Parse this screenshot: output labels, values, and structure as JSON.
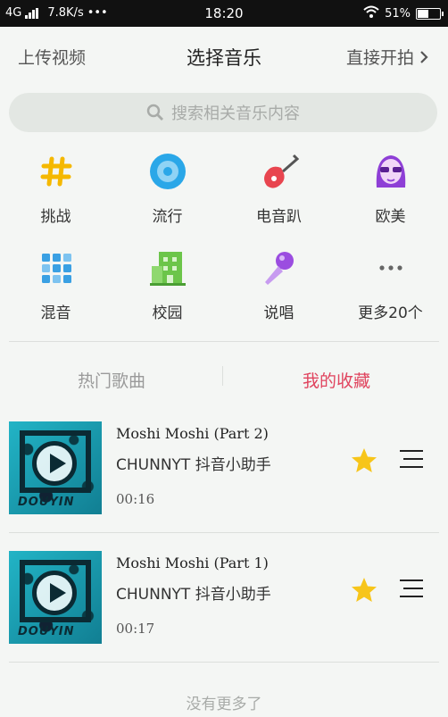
{
  "statusbar": {
    "network": "4G",
    "speed": "7.8K/s",
    "dots": "•••",
    "time": "18:20",
    "battery": "51%",
    "battery_level": 0.51
  },
  "header": {
    "upload_video": "上传视频",
    "title": "选择音乐",
    "direct_shoot": "直接开拍"
  },
  "search": {
    "placeholder": "搜索相关音乐内容"
  },
  "categories": [
    {
      "label": "挑战",
      "icon": "hashtag-icon",
      "color": "#f5b800"
    },
    {
      "label": "流行",
      "icon": "vinyl-disc-icon",
      "color": "#2aa7e8"
    },
    {
      "label": "电音趴",
      "icon": "electric-guitar-icon",
      "color": "#e8454f"
    },
    {
      "label": "欧美",
      "icon": "woman-sunglasses-icon",
      "color": "#8e3fd6"
    },
    {
      "label": "混音",
      "icon": "grid-squares-icon",
      "color": "#3aa0e3"
    },
    {
      "label": "校园",
      "icon": "school-building-icon",
      "color": "#6cc54a"
    },
    {
      "label": "说唱",
      "icon": "microphone-icon",
      "color": "#9b4de0"
    },
    {
      "label": "更多20个",
      "icon": "more-dots-icon",
      "color": "#666666"
    }
  ],
  "tabs": {
    "hot": "热门歌曲",
    "favorites": "我的收藏"
  },
  "songs": [
    {
      "title": "Moshi Moshi (Part 2)",
      "artist": "CHUNNYT 抖音小助手",
      "duration": "00:16",
      "cover_brand": "DOUYIN"
    },
    {
      "title": "Moshi Moshi (Part 1)",
      "artist": "CHUNNYT 抖音小助手",
      "duration": "00:17",
      "cover_brand": "DOUYIN"
    }
  ],
  "footer": {
    "no_more": "没有更多了"
  },
  "colors": {
    "accent": "#e0445e",
    "star": "#f7c51a"
  }
}
